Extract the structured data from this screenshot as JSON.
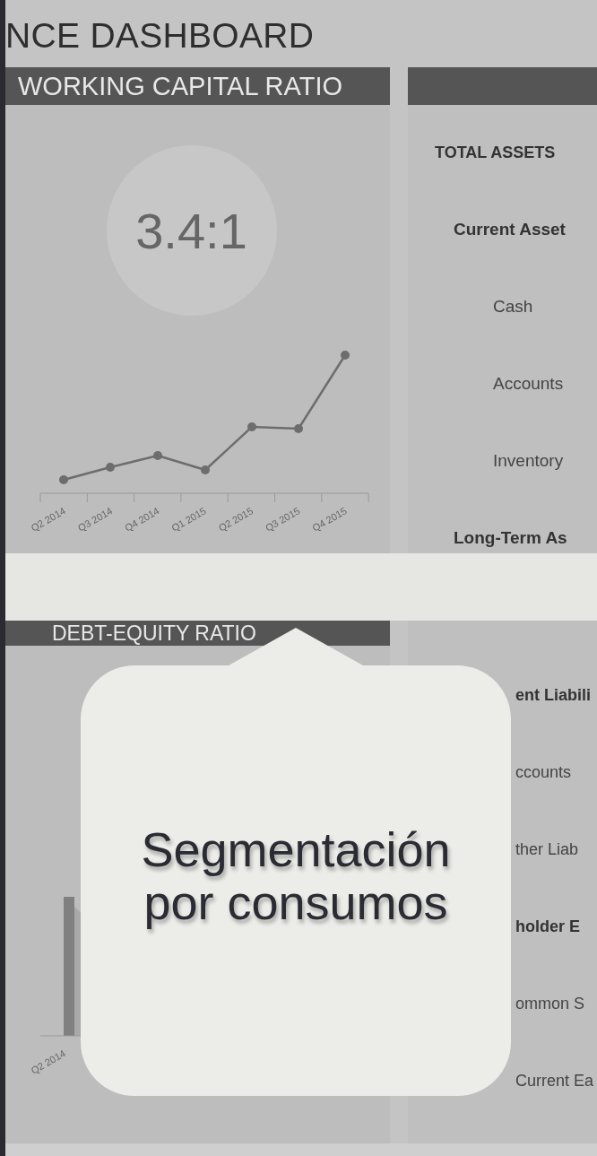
{
  "title": "NCE DASHBOARD",
  "top": {
    "left": {
      "header": "WORKING CAPITAL RATIO",
      "ratio": "3.4:1",
      "x_labels": [
        "Q2 2014",
        "Q3 2014",
        "Q4 2014",
        "Q1 2015",
        "Q2 2015",
        "Q3 2015",
        "Q4 2015"
      ]
    },
    "right": {
      "items": [
        {
          "kind": "section",
          "label": "TOTAL ASSETS"
        },
        {
          "kind": "group",
          "label": "Current Asset"
        },
        {
          "kind": "item",
          "label": "Cash"
        },
        {
          "kind": "item",
          "label": "Accounts"
        },
        {
          "kind": "item",
          "label": "Inventory"
        },
        {
          "kind": "group",
          "label": "Long-Term As"
        }
      ]
    }
  },
  "bottom": {
    "left": {
      "header": "DEBT-EQUITY RATIO",
      "x_labels": [
        "Q2 2014"
      ]
    },
    "right": {
      "items": [
        {
          "kind": "group",
          "label": "ent Liabili"
        },
        {
          "kind": "item",
          "label": "ccounts"
        },
        {
          "kind": "item",
          "label": "ther Liab"
        },
        {
          "kind": "group",
          "label": "holder E"
        },
        {
          "kind": "item",
          "label": "ommon S"
        },
        {
          "kind": "item",
          "label": "Current Ea"
        }
      ]
    }
  },
  "tooltip": {
    "text": "Segmentación\npor consumos"
  }
}
